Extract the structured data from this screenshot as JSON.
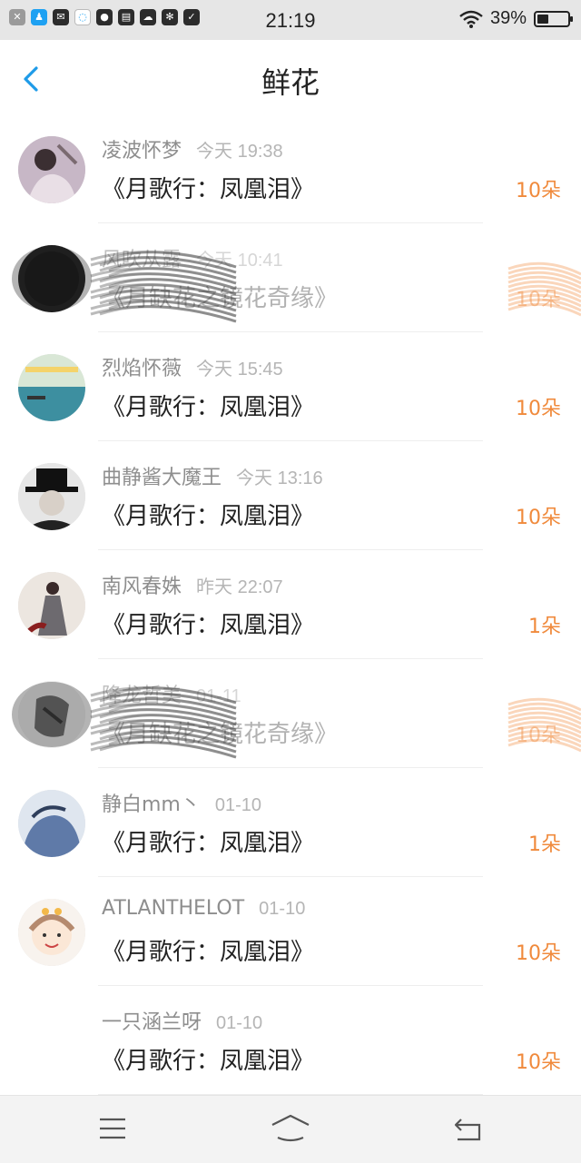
{
  "status_bar": {
    "time": "21:19",
    "battery_percent": "39%",
    "battery_level": 0.39,
    "notification_icons": [
      "close-box-icon",
      "qq-penguin-icon",
      "message-icon",
      "chat-bubble-icon",
      "planet-icon",
      "book-icon",
      "cloud-icon",
      "pinwheel-icon",
      "shield-icon"
    ]
  },
  "header": {
    "title": "鲜花",
    "back_icon": "chevron-left-icon"
  },
  "items": [
    {
      "name": "凌波怀梦",
      "time": "今天 19:38",
      "gift": "《月歌行：凤凰泪》",
      "count": "10朵",
      "obscured": false,
      "avatar": "photo"
    },
    {
      "name": "风吹从露",
      "time": "今天 10:41",
      "gift": "《月缺花之镜花奇缘》",
      "count": "10朵",
      "obscured": true,
      "avatar": "dark"
    },
    {
      "name": "烈焰怀薇",
      "time": "今天 15:45",
      "gift": "《月歌行：凤凰泪》",
      "count": "10朵",
      "obscured": false,
      "avatar": "seaside"
    },
    {
      "name": "曲静酱大魔王",
      "time": "今天 13:16",
      "gift": "《月歌行：凤凰泪》",
      "count": "10朵",
      "obscured": false,
      "avatar": "hat"
    },
    {
      "name": "南风春姝",
      "time": "昨天 22:07",
      "gift": "《月歌行：凤凰泪》",
      "count": "1朵",
      "obscured": false,
      "avatar": "costume"
    },
    {
      "name": "降龙哲美",
      "time": "01-11",
      "gift": "《月缺花之镜花奇缘》",
      "count": "10朵",
      "obscured": true,
      "avatar": "sketch"
    },
    {
      "name": "静白mm丶",
      "time": "01-10",
      "gift": "《月歌行：凤凰泪》",
      "count": "1朵",
      "obscured": false,
      "avatar": "anime-blue"
    },
    {
      "name": "ATLANTHELOT",
      "time": "01-10",
      "gift": "《月歌行：凤凰泪》",
      "count": "10朵",
      "obscured": false,
      "avatar": "anime-girl"
    },
    {
      "name": "一只涵兰呀",
      "time": "01-10",
      "gift": "《月歌行：凤凰泪》",
      "count": "10朵",
      "obscured": false,
      "avatar": "none"
    }
  ],
  "bottom_nav": {
    "menu_icon": "menu-icon",
    "home_icon": "home-icon",
    "back_icon": "back-arrow-icon"
  },
  "colors": {
    "accent_blue": "#1e9be8",
    "count_orange": "#f08a3c",
    "name_gray": "#8e8e8e",
    "time_gray": "#b5b5b5"
  }
}
